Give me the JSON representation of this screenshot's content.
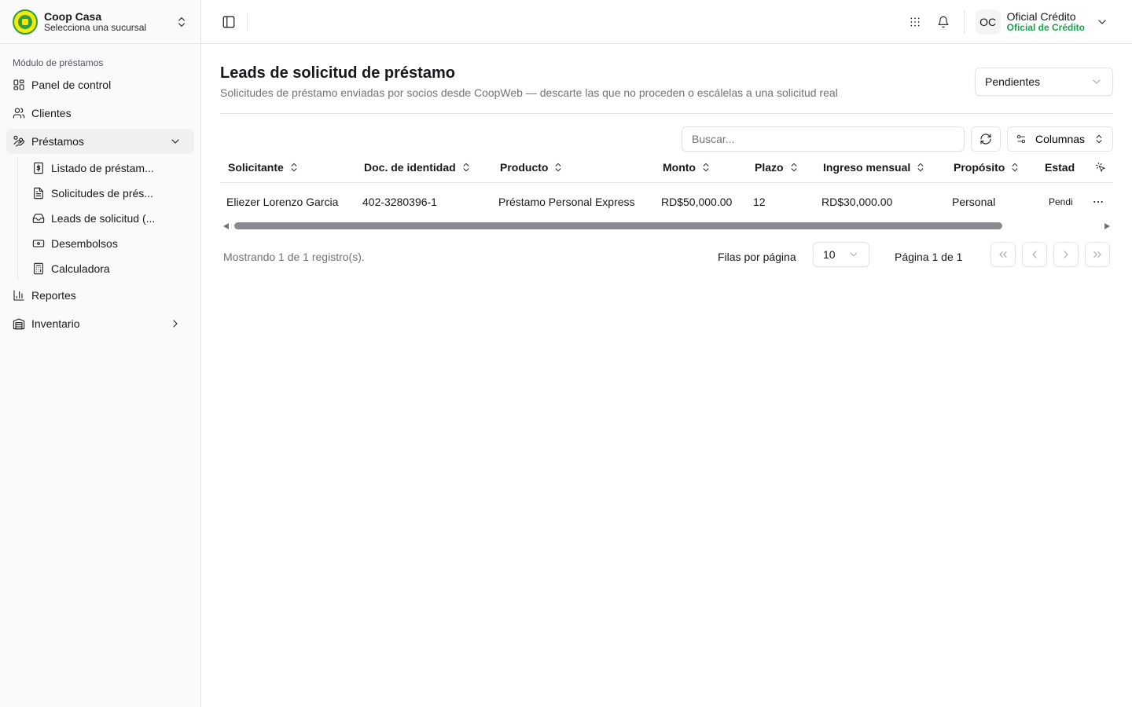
{
  "org": {
    "name": "Coop Casa",
    "subtitle": "Selecciona una sucursal"
  },
  "sidebar": {
    "group_label": "Módulo de préstamos",
    "items": [
      {
        "label": "Panel de control",
        "icon": "layout-grid-icon"
      },
      {
        "label": "Clientes",
        "icon": "users-icon"
      },
      {
        "label": "Préstamos",
        "icon": "hand-coins-icon",
        "expanded": true,
        "children": [
          {
            "label": "Listado de préstam...",
            "icon": "dollar-file-icon"
          },
          {
            "label": "Solicitudes de prés...",
            "icon": "file-text-icon"
          },
          {
            "label": "Leads de solicitud (...",
            "icon": "inbox-icon"
          },
          {
            "label": "Desembolsos",
            "icon": "banknote-icon"
          },
          {
            "label": "Calculadora",
            "icon": "calculator-icon"
          }
        ]
      },
      {
        "label": "Reportes",
        "icon": "bar-chart-icon"
      },
      {
        "label": "Inventario",
        "icon": "warehouse-icon"
      }
    ]
  },
  "topbar": {
    "user": {
      "initials": "OC",
      "name": "Oficial Crédito",
      "role": "Oficial de Crédito"
    }
  },
  "page": {
    "title": "Leads de solicitud de préstamo",
    "subtitle": "Solicitudes de préstamo enviadas por socios desde CoopWeb — descarte las que no proceden o escálelas a una solicitud real",
    "status_filter": "Pendientes"
  },
  "toolbar": {
    "search_placeholder": "Buscar...",
    "columns_label": "Columnas"
  },
  "table": {
    "headers": [
      "Solicitante",
      "Doc. de identidad",
      "Producto",
      "Monto",
      "Plazo",
      "Ingreso mensual",
      "Propósito",
      "Estad"
    ],
    "rows": [
      [
        "Eliezer Lorenzo Garcia",
        "402-3280396-1",
        "Préstamo Personal Express",
        "RD$50,000.00",
        "12",
        "RD$30,000.00",
        "Personal",
        "Pendi"
      ]
    ]
  },
  "footer": {
    "count_text": "Mostrando 1 de 1 registro(s).",
    "rows_per_page_label": "Filas por página",
    "rows_per_page": "10",
    "page_text": "Página 1 de 1"
  }
}
